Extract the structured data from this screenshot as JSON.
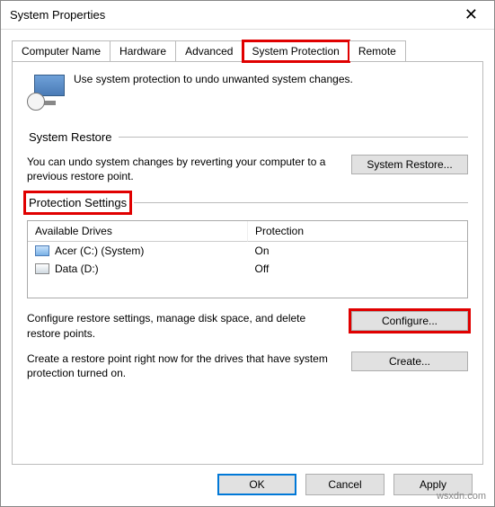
{
  "window": {
    "title": "System Properties"
  },
  "tabs": [
    {
      "label": "Computer Name"
    },
    {
      "label": "Hardware"
    },
    {
      "label": "Advanced"
    },
    {
      "label": "System Protection"
    },
    {
      "label": "Remote"
    }
  ],
  "intro": {
    "text": "Use system protection to undo unwanted system changes."
  },
  "system_restore": {
    "header": "System Restore",
    "desc": "You can undo system changes by reverting your computer to a previous restore point.",
    "button": "System Restore..."
  },
  "protection": {
    "header": "Protection Settings",
    "columns": {
      "drives": "Available Drives",
      "protection": "Protection"
    },
    "drives": [
      {
        "name": "Acer (C:) (System)",
        "status": "On"
      },
      {
        "name": "Data (D:)",
        "status": "Off"
      }
    ],
    "configure_desc": "Configure restore settings, manage disk space, and delete restore points.",
    "configure_button": "Configure...",
    "create_desc": "Create a restore point right now for the drives that have system protection turned on.",
    "create_button": "Create..."
  },
  "footer": {
    "ok": "OK",
    "cancel": "Cancel",
    "apply": "Apply"
  },
  "watermark": "wsxdn.com"
}
